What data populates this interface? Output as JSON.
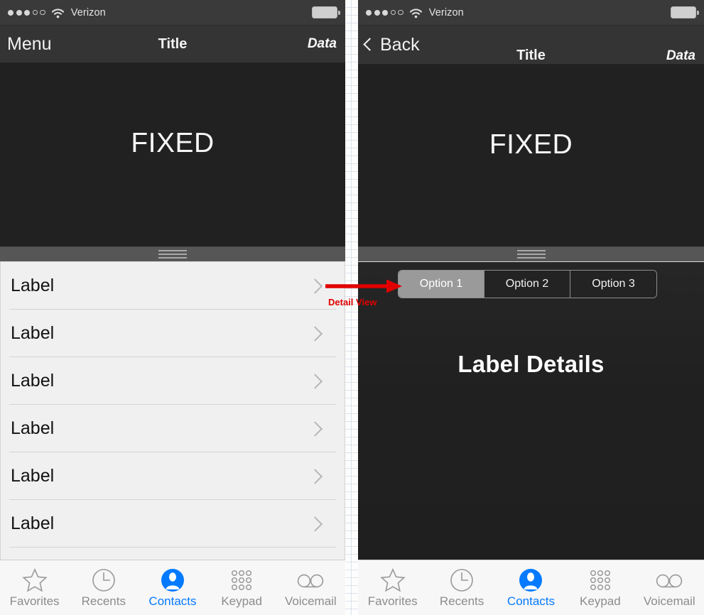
{
  "status_bar": {
    "signal_dots_filled": 3,
    "signal_dots_total": 5,
    "wifi_icon": "wifi-icon",
    "carrier": "Verizon",
    "battery_icon": "battery-icon"
  },
  "left_panel": {
    "nav": {
      "menu_label": "Menu",
      "title": "Title",
      "data_label": "Data"
    },
    "fixed_label": "FIXED",
    "handle": "drag-handle",
    "list_rows": [
      {
        "label": "Label"
      },
      {
        "label": "Label"
      },
      {
        "label": "Label"
      },
      {
        "label": "Label"
      },
      {
        "label": "Label"
      },
      {
        "label": "Label"
      }
    ]
  },
  "right_panel": {
    "nav": {
      "back_label": "Back",
      "title": "Title",
      "data_label": "Data"
    },
    "fixed_label": "FIXED",
    "segmented": [
      {
        "label": "Option 1",
        "selected": true
      },
      {
        "label": "Option 2",
        "selected": false
      },
      {
        "label": "Option 3",
        "selected": false
      }
    ],
    "detail_title": "Label Details"
  },
  "annotation": {
    "label": "Detail View",
    "color": "#e00000"
  },
  "tab_bar": {
    "active_color": "#067aff",
    "inactive_color": "#8c8c8c",
    "tabs": [
      {
        "label": "Favorites",
        "icon": "star-icon",
        "active": false
      },
      {
        "label": "Recents",
        "icon": "clock-icon",
        "active": false
      },
      {
        "label": "Contacts",
        "icon": "contact-person-icon",
        "active": true
      },
      {
        "label": "Keypad",
        "icon": "keypad-dots-icon",
        "active": false
      },
      {
        "label": "Voicemail",
        "icon": "voicemail-icon",
        "active": false
      }
    ]
  }
}
